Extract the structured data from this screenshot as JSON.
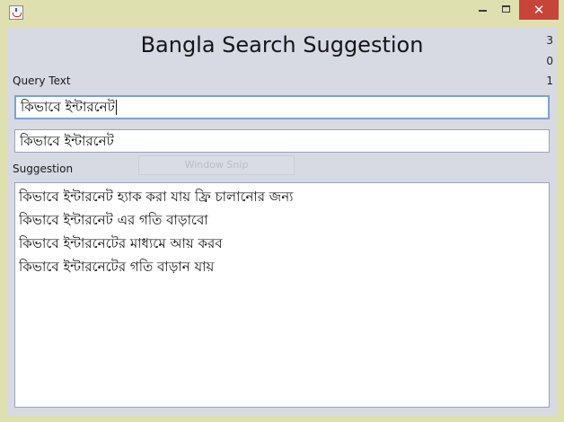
{
  "window": {
    "icon": "java-cup-icon",
    "close_glyph": "✕"
  },
  "header": {
    "title": "Bangla Search Suggestion",
    "counters": [
      "3",
      "0",
      "1"
    ]
  },
  "query": {
    "label": "Query Text",
    "value": "কিভাবে ইন্টারনেট"
  },
  "mirror": {
    "value": "কিভাবে ইন্টারনেট"
  },
  "overlay": {
    "text": "Window Snip"
  },
  "suggestion": {
    "label": "Suggestion",
    "items": [
      "কিভাবে ইন্টারনেট হ্যাক করা যায় ফ্রি চালানোর জন্য",
      "কিভাবে ইন্টারনেট এর গতি বাড়াবো",
      "কিভাবে ইন্টারনেটের মাধ্যমে আয় করব",
      "কিভাবে ইন্টারনেটের গতি বাড়ান যায়"
    ]
  }
}
